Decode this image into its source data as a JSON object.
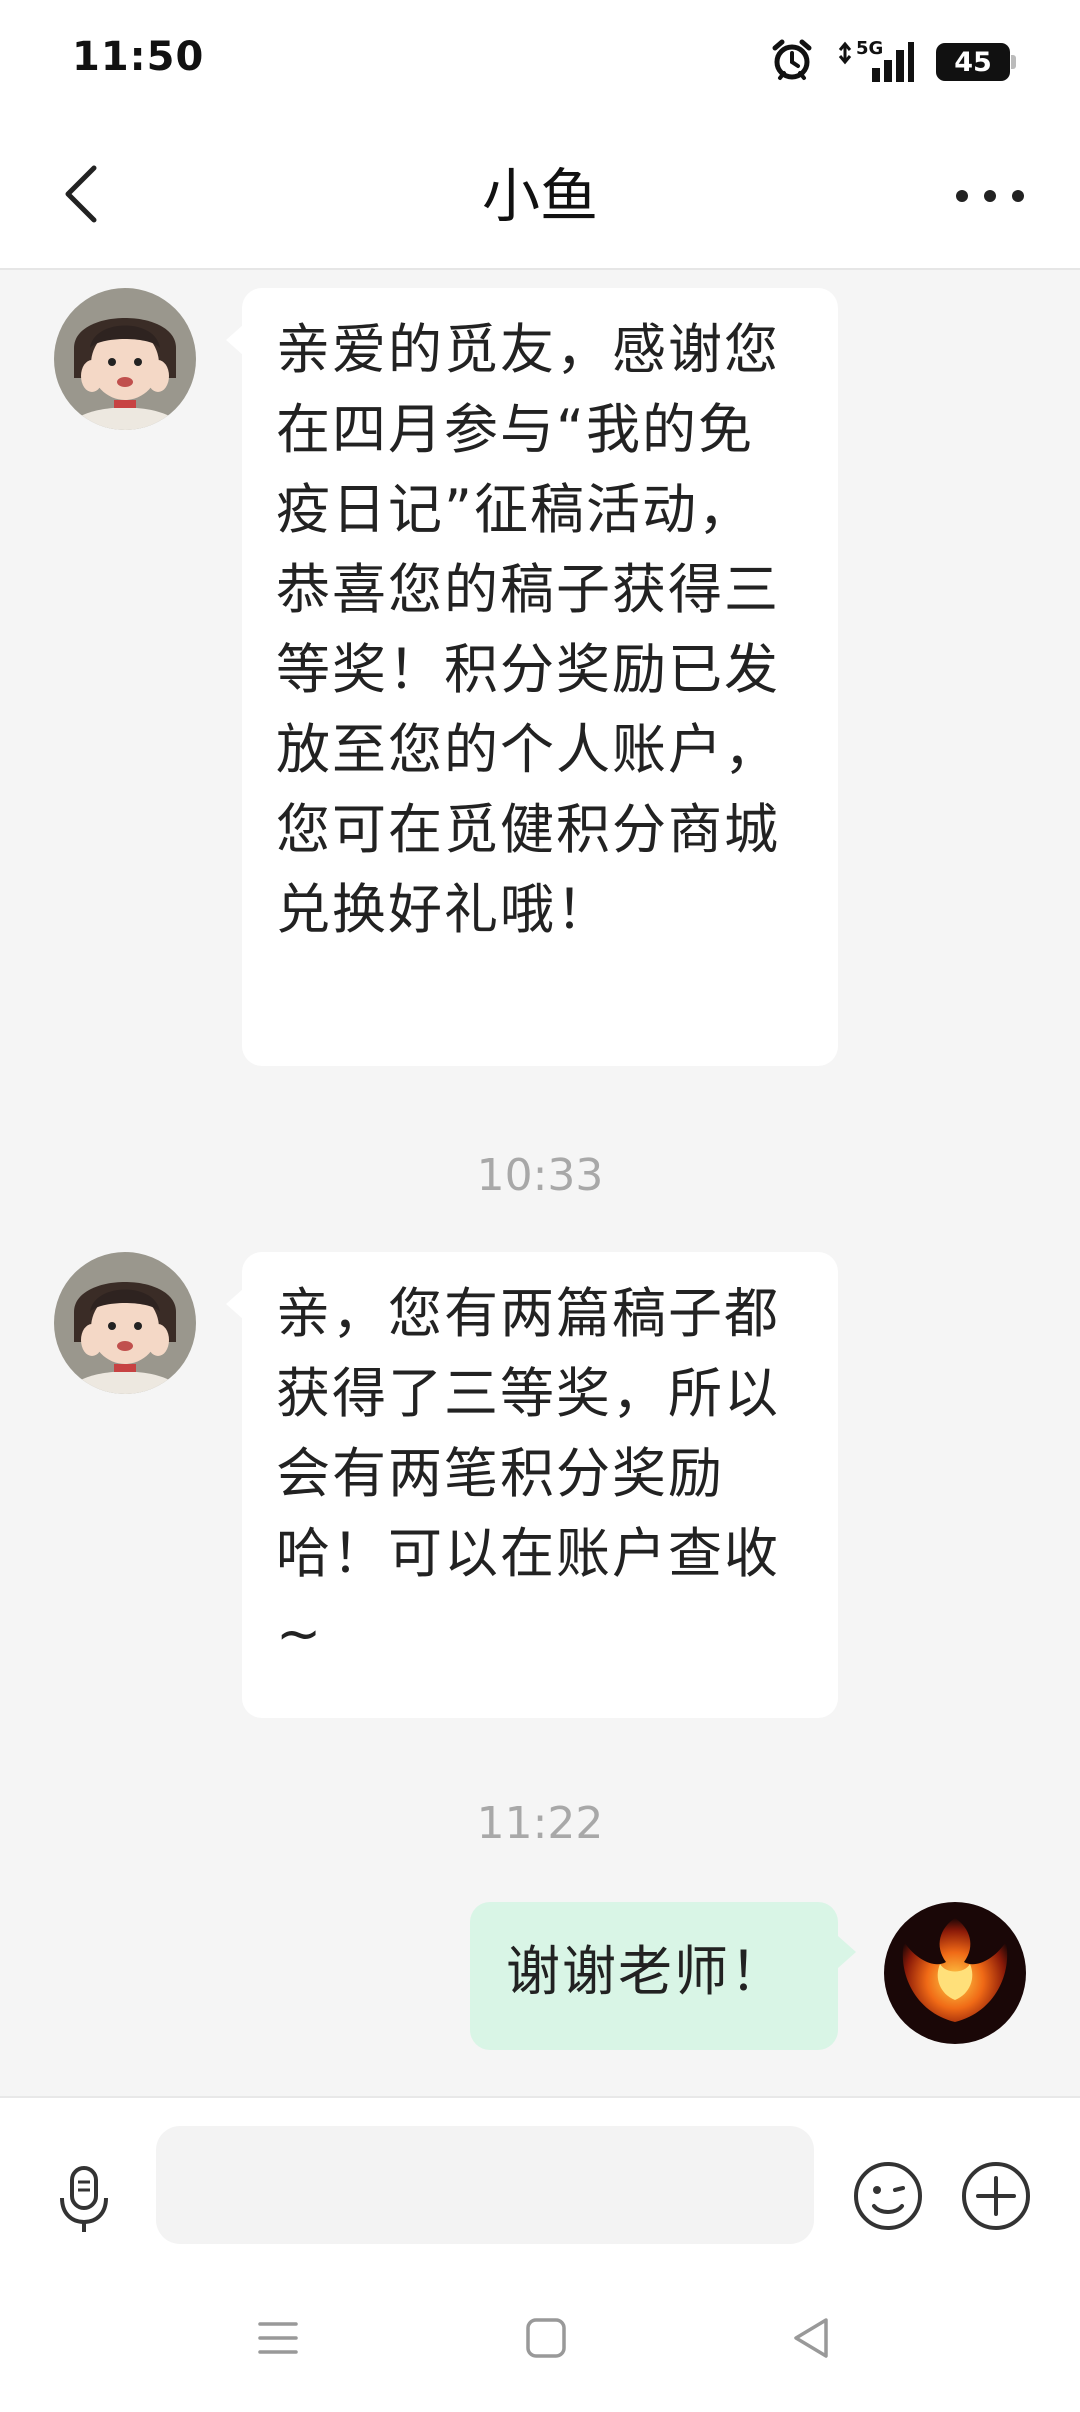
{
  "status_bar": {
    "time": "11:50",
    "network": "5G",
    "battery": "45",
    "icons": [
      "alarm-clock-icon",
      "signal-5g-icon",
      "battery-icon"
    ]
  },
  "header": {
    "title": "小鱼",
    "back_icon": "chevron-left-icon",
    "more_icon": "more-dots-icon"
  },
  "messages": [
    {
      "direction": "incoming",
      "text": "亲爱的觅友，感谢您在四月参与“我的免疫日记”征稿活动，恭喜您的稿子获得三等奖！积分奖励已发放至您的个人账户，您可在觅健积分商城兑换好礼哦！"
    },
    {
      "type": "timestamp",
      "text": "10:33"
    },
    {
      "direction": "incoming",
      "text": "亲，您有两篇稿子都获得了三等奖，所以会有两笔积分奖励哈！可以在账户查收~"
    },
    {
      "type": "timestamp",
      "text": "11:22"
    },
    {
      "direction": "outgoing",
      "text": "谢谢老师！"
    }
  ],
  "input_bar": {
    "placeholder": "",
    "value": "",
    "icons": [
      "microphone-icon",
      "emoji-icon",
      "plus-icon"
    ]
  },
  "system_nav": [
    "menu-icon",
    "home-square-icon",
    "back-triangle-icon"
  ],
  "colors": {
    "background": "#f5f5f5",
    "incoming_bubble": "#ffffff",
    "outgoing_bubble": "#d9f5e6",
    "timestamp": "#a8a8a8"
  }
}
